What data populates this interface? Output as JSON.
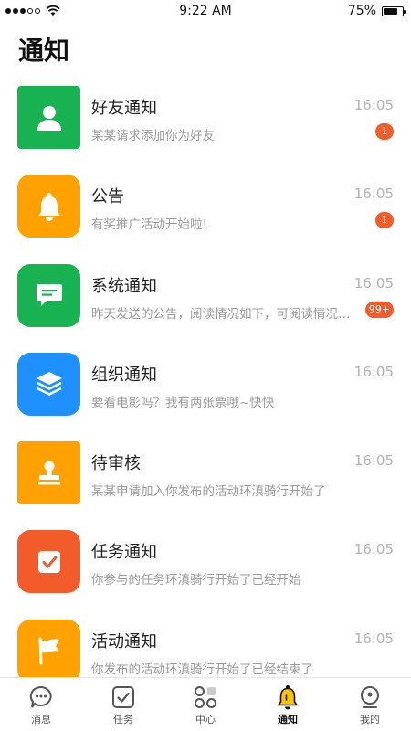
{
  "status": {
    "time": "9:22 AM",
    "battery": "75%",
    "battery_level": 0.75
  },
  "header": {
    "title": "通知"
  },
  "items": [
    {
      "title": "好友通知",
      "time": "16:05",
      "subtitle": "某某请求添加你为好友",
      "badge": "1",
      "icon": "user-icon",
      "color": "#19b252"
    },
    {
      "title": "公告",
      "time": "16:05",
      "subtitle": "有奖推广活动开始啦!",
      "badge": "1",
      "icon": "bell-icon",
      "color": "#ffa200"
    },
    {
      "title": "系统通知",
      "time": "16:05",
      "subtitle": "昨天发送的公告，阅读情况如下，可阅读情况如下",
      "badge": "99+",
      "icon": "message-icon",
      "color": "#19b252"
    },
    {
      "title": "组织通知",
      "time": "16:05",
      "subtitle": "要看电影吗？我有两张票哦~快快",
      "badge": "",
      "icon": "layers-icon",
      "color": "#1e90ff"
    },
    {
      "title": "待审核",
      "time": "16:05",
      "subtitle": "某某申请加入你发布的活动环滇骑行开始了",
      "badge": "",
      "icon": "stamp-icon",
      "color": "#ffa200"
    },
    {
      "title": "任务通知",
      "time": "16:05",
      "subtitle": "你参与的任务环滇骑行开始了已经开始",
      "badge": "",
      "icon": "checkbox-icon",
      "color": "#f25c2b"
    },
    {
      "title": "活动通知",
      "time": "16:05",
      "subtitle": "你发布的活动环滇骑行开始了已经结束了",
      "badge": "",
      "icon": "flag-icon",
      "color": "#ffa200"
    }
  ],
  "tabs": [
    {
      "label": "消息",
      "icon": "chat-icon",
      "active": false
    },
    {
      "label": "任务",
      "icon": "task-icon",
      "active": false
    },
    {
      "label": "中心",
      "icon": "grid-icon",
      "active": false
    },
    {
      "label": "通知",
      "icon": "bell-icon",
      "active": true
    },
    {
      "label": "我的",
      "icon": "profile-icon",
      "active": false
    }
  ]
}
